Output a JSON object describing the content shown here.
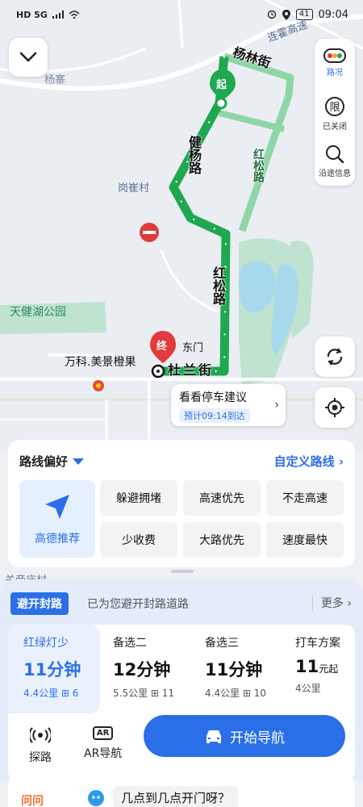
{
  "status_bar": {
    "left_icons": "HD 5G",
    "battery": "41",
    "time": "09:04"
  },
  "map": {
    "place_labels": {
      "yangzhai": "杨寨",
      "gangcuncun": "岗崔村",
      "tianjianhu_park": "天健湖公园",
      "wanke": "万科.美景橙果",
      "east_gate": "东门",
      "guanyindian": "关帝庙村",
      "highway": "连霍高速",
      "top_right": "高速"
    },
    "road_labels": {
      "yanglin": "杨林街",
      "jianyang": "健杨路",
      "hongsong_upper": "红松路",
      "hongsong_lower": "红松路",
      "dulan": "杜兰街"
    },
    "start_marker": "起",
    "end_marker": "终",
    "parking_card": {
      "title": "看看停车建议",
      "eta": "预计09:14到达"
    }
  },
  "right_tools": [
    {
      "label": "路况",
      "icon": "traffic-light-icon"
    },
    {
      "label": "已关闭",
      "icon": "restriction-icon"
    },
    {
      "label": "沿途信息",
      "icon": "search-along-icon"
    }
  ],
  "preference": {
    "title": "路线偏好",
    "custom": "自定义路线",
    "recommended": "高德推荐",
    "options": [
      "躲避拥堵",
      "高速优先",
      "不走高速",
      "少收费",
      "大路优先",
      "速度最快"
    ]
  },
  "bypass": {
    "pill": "避开封路",
    "text": "已为您避开封路道路",
    "more": "更多"
  },
  "routes": [
    {
      "name": "红绿灯少",
      "duration": "11分钟",
      "distance": "4.4公里",
      "lights": "6"
    },
    {
      "name": "备选二",
      "duration": "12分钟",
      "distance": "5.5公里",
      "lights": "11"
    },
    {
      "name": "备选三",
      "duration": "11分钟",
      "distance": "4.4公里",
      "lights": "10"
    },
    {
      "name": "打车方案",
      "duration_num": "11",
      "duration_unit": "元起",
      "distance": "4公里"
    }
  ],
  "actions": {
    "explore": "探路",
    "ar": "AR导航",
    "ar_badge": "AR",
    "start_nav": "开始导航"
  },
  "ask": {
    "tag": "问问",
    "question": "几点到几点开门呀？"
  }
}
